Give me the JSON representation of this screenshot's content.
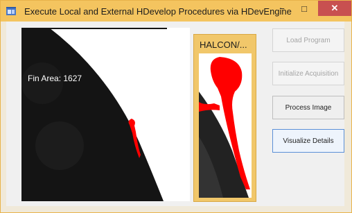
{
  "window": {
    "title": "Execute Local and External HDevelop Procedures via HDevEngine",
    "minimize_glyph": "−",
    "maximize_glyph": "□",
    "close_glyph": "✕"
  },
  "viewer": {
    "label": "Fin Area: 1627"
  },
  "detail_panel": {
    "title": "HALCON/..."
  },
  "buttons": {
    "load_program": "Load Program",
    "initialize_acquisition": "Initialize Acquisition",
    "process_image": "Process Image",
    "visualize_details": "Visualize Details"
  },
  "states": {
    "load_program_enabled": false,
    "initialize_acquisition_enabled": false,
    "process_image_enabled": true,
    "visualize_details_enabled": true
  },
  "icons": [
    "app-icon",
    "minimize-icon",
    "maximize-icon",
    "close-icon"
  ],
  "colors": {
    "titlebar": "#f4c45f",
    "close": "#c85050",
    "panel": "#f1c76a",
    "fin_region": "#ff0000"
  }
}
